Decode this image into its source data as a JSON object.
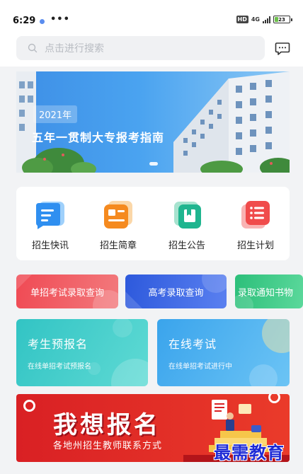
{
  "status_bar": {
    "time": "6:29",
    "more": "•••",
    "hd": "HD",
    "network": "4G",
    "battery": "23",
    "battery_level": 0.23
  },
  "search": {
    "placeholder": "点击进行搜索"
  },
  "banner": {
    "year": "2021年",
    "title": "五年一贯制大专报考指南"
  },
  "quick_links": [
    {
      "label": "招生快讯",
      "icon": "news-icon",
      "color": "#2f8ff0"
    },
    {
      "label": "招生简章",
      "icon": "brochure-icon",
      "color": "#f58a1f"
    },
    {
      "label": "招生公告",
      "icon": "announcement-icon",
      "color": "#1fb58f"
    },
    {
      "label": "招生计划",
      "icon": "plan-icon",
      "color": "#f04b4b"
    }
  ],
  "pills": [
    {
      "label": "单招考试录取查询",
      "color": "#f04a54"
    },
    {
      "label": "高考录取查询",
      "color": "#2d59dc"
    },
    {
      "label": "录取通知书物",
      "color": "#2cbf7a"
    }
  ],
  "cards": [
    {
      "title": "考生预报名",
      "subtitle": "在线单招考试预报名",
      "color": "#32c4c4"
    },
    {
      "title": "在线考试",
      "subtitle": "在线单招考试进行中",
      "color": "#3aa4ec"
    }
  ],
  "promo": {
    "title": "我想报名",
    "subtitle": "各地州招生教师联系方式"
  },
  "watermark": "最需教育"
}
